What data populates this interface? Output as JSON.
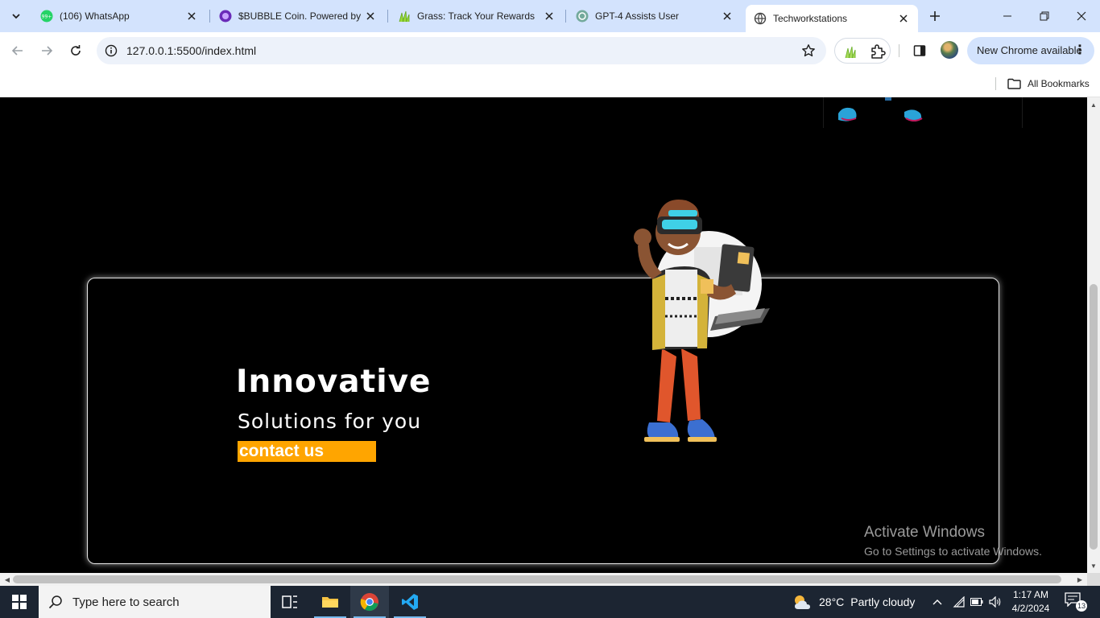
{
  "browser": {
    "tabs": [
      {
        "title": "(106) WhatsApp",
        "icon": "whatsapp-icon",
        "badge": "99+",
        "active": false
      },
      {
        "title": "$BUBBLE Coin. Powered by Bubbles",
        "icon": "bubble-coin-icon",
        "active": false
      },
      {
        "title": "Grass: Track Your Rewards",
        "icon": "grass-icon",
        "active": false
      },
      {
        "title": "GPT-4 Assists User",
        "icon": "openai-icon",
        "active": false
      },
      {
        "title": "Techworkstations",
        "icon": "globe-icon",
        "active": true
      }
    ],
    "address": {
      "url": "127.0.0.1:5500/index.html"
    },
    "update_label": "New Chrome available",
    "bookmarks": {
      "all_label": "All Bookmarks"
    },
    "accent": "#d3e3fd"
  },
  "page": {
    "hero": {
      "title": "Innovative",
      "subtitle": "Solutions for you",
      "cta_label": "contact us",
      "cta_color": "#ffa500"
    }
  },
  "watermark": {
    "line1": "Activate Windows",
    "line2": "Go to Settings to activate Windows."
  },
  "taskbar": {
    "search_placeholder": "Type here to search",
    "weather": {
      "temp": "28°C",
      "condition": "Partly cloudy"
    },
    "clock": {
      "time": "1:17 AM",
      "date": "4/2/2024"
    },
    "notifications": "13"
  }
}
